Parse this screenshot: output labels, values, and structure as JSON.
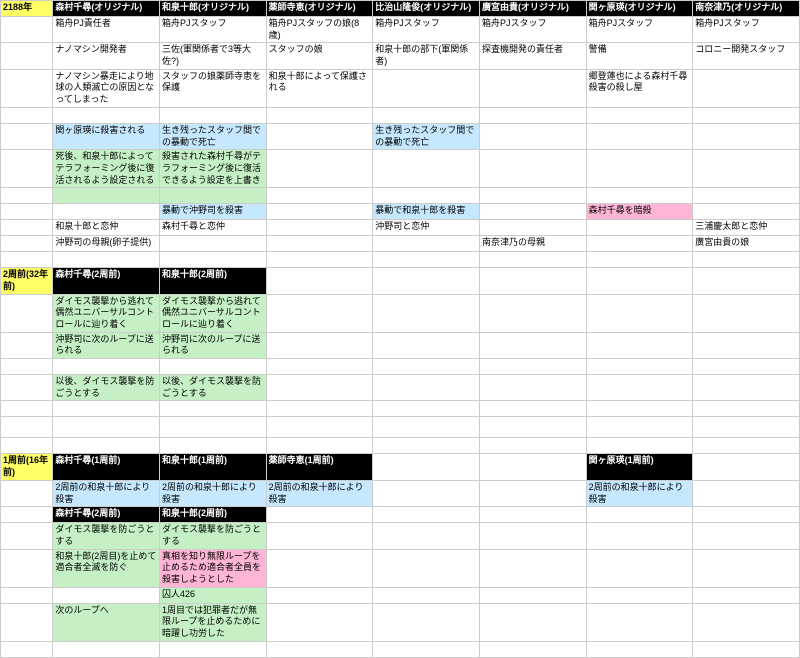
{
  "sec1": {
    "year": "2188年",
    "h": [
      "森村千尋(オリジナル)",
      "和泉十郎(オリジナル)",
      "薬師寺恵(オリジナル)",
      "比治山隆俊(オリジナル)",
      "廣宮由貴(オリジナル)",
      "関ヶ原瑛(オリジナル)",
      "南奈津乃(オリジナル)"
    ],
    "r1": [
      "箱舟PJ責任者",
      "箱舟PJスタッフ",
      "箱舟PJスタッフの娘(8歳)",
      "箱舟PJスタッフ",
      "箱舟PJスタッフ",
      "箱舟PJスタッフ",
      "箱舟PJスタッフ"
    ],
    "r2": [
      "ナノマシン開発者",
      "三佐(軍関係者で3等大佐?)",
      "スタッフの娘",
      "和泉十郎の部下(軍関係者)",
      "探査機開発の責任者",
      "警備",
      "コロニー開発スタッフ"
    ],
    "r3": [
      "ナノマシン暴走により地球の人類滅亡の原因となってしまった",
      "スタッフの娘薬師寺恵を保護",
      "和泉十郎によって保護される",
      "",
      "",
      "郷登蓮也による森村千尋殺害の殺し屋",
      ""
    ],
    "r4": [
      "関ヶ原瑛に殺害される",
      "生き残ったスタッフ間での暴動で死亡",
      "",
      "生き残ったスタッフ間での暴動で死亡",
      "",
      "",
      ""
    ],
    "r5": [
      "死後、和泉十郎によってテラフォーミング後に復活されるよう設定される",
      "殺害された森村千尋がテラフォーミング後に復活できるよう設定を上書き",
      "",
      "",
      "",
      "",
      ""
    ],
    "r6": [
      "",
      "暴動で沖野司を殺害",
      "",
      "暴動で和泉十郎を殺害",
      "",
      "森村千尋を暗殺",
      ""
    ],
    "r7": [
      "和泉十郎と恋仲",
      "森村千尋と恋仲",
      "",
      "沖野司と恋仲",
      "",
      "",
      "三浦慶太郎と恋仲"
    ],
    "r8": [
      "沖野司の母親(卵子提供)",
      "",
      "",
      "",
      "南奈津乃の母親",
      "",
      "廣宮由貴の娘"
    ]
  },
  "sec2": {
    "year": "2周前(32年前)",
    "h": [
      "森村千尋(2周前)",
      "和泉十郎(2周前)"
    ],
    "r1": [
      "ダイモス襲撃から逃れて偶然ユニバーサルコントロールに辿り着く",
      "ダイモス襲撃から逃れて偶然ユニバーサルコントロールに辿り着く"
    ],
    "r2": [
      "沖野司に次のループに送られる",
      "沖野司に次のループに送られる"
    ],
    "r3": [
      "以後、ダイモス襲撃を防ごうとする",
      "以後、ダイモス襲撃を防ごうとする"
    ]
  },
  "sec3": {
    "year": "1周前(16年前)",
    "h": [
      "森村千尋(1周前)",
      "和泉十郎(1周前)",
      "薬師寺恵(1周前)",
      "",
      "",
      "関ヶ原瑛(1周前)",
      ""
    ],
    "r1": [
      "2周前の和泉十郎により殺害",
      "2周前の和泉十郎により殺害",
      "2周前の和泉十郎により殺害",
      "",
      "",
      "2周前の和泉十郎により殺害",
      ""
    ],
    "sub": [
      "森村千尋(2周前)",
      "和泉十郎(2周前)"
    ],
    "r2a": "ダイモス襲撃を防ごうとする",
    "r2b": "ダイモス襲撃を防ごうとする",
    "r3a": "和泉十郎(2周目)を止めて適合者全滅を防ぐ",
    "r3b": "真相を知り無限ループを止めるため適合者全員を殺害しようとした",
    "r4b": "囚人426",
    "r5a": "次のループへ",
    "r5b": "1周目では犯罪者だが無限ループを止めるために暗躍し功労した"
  }
}
